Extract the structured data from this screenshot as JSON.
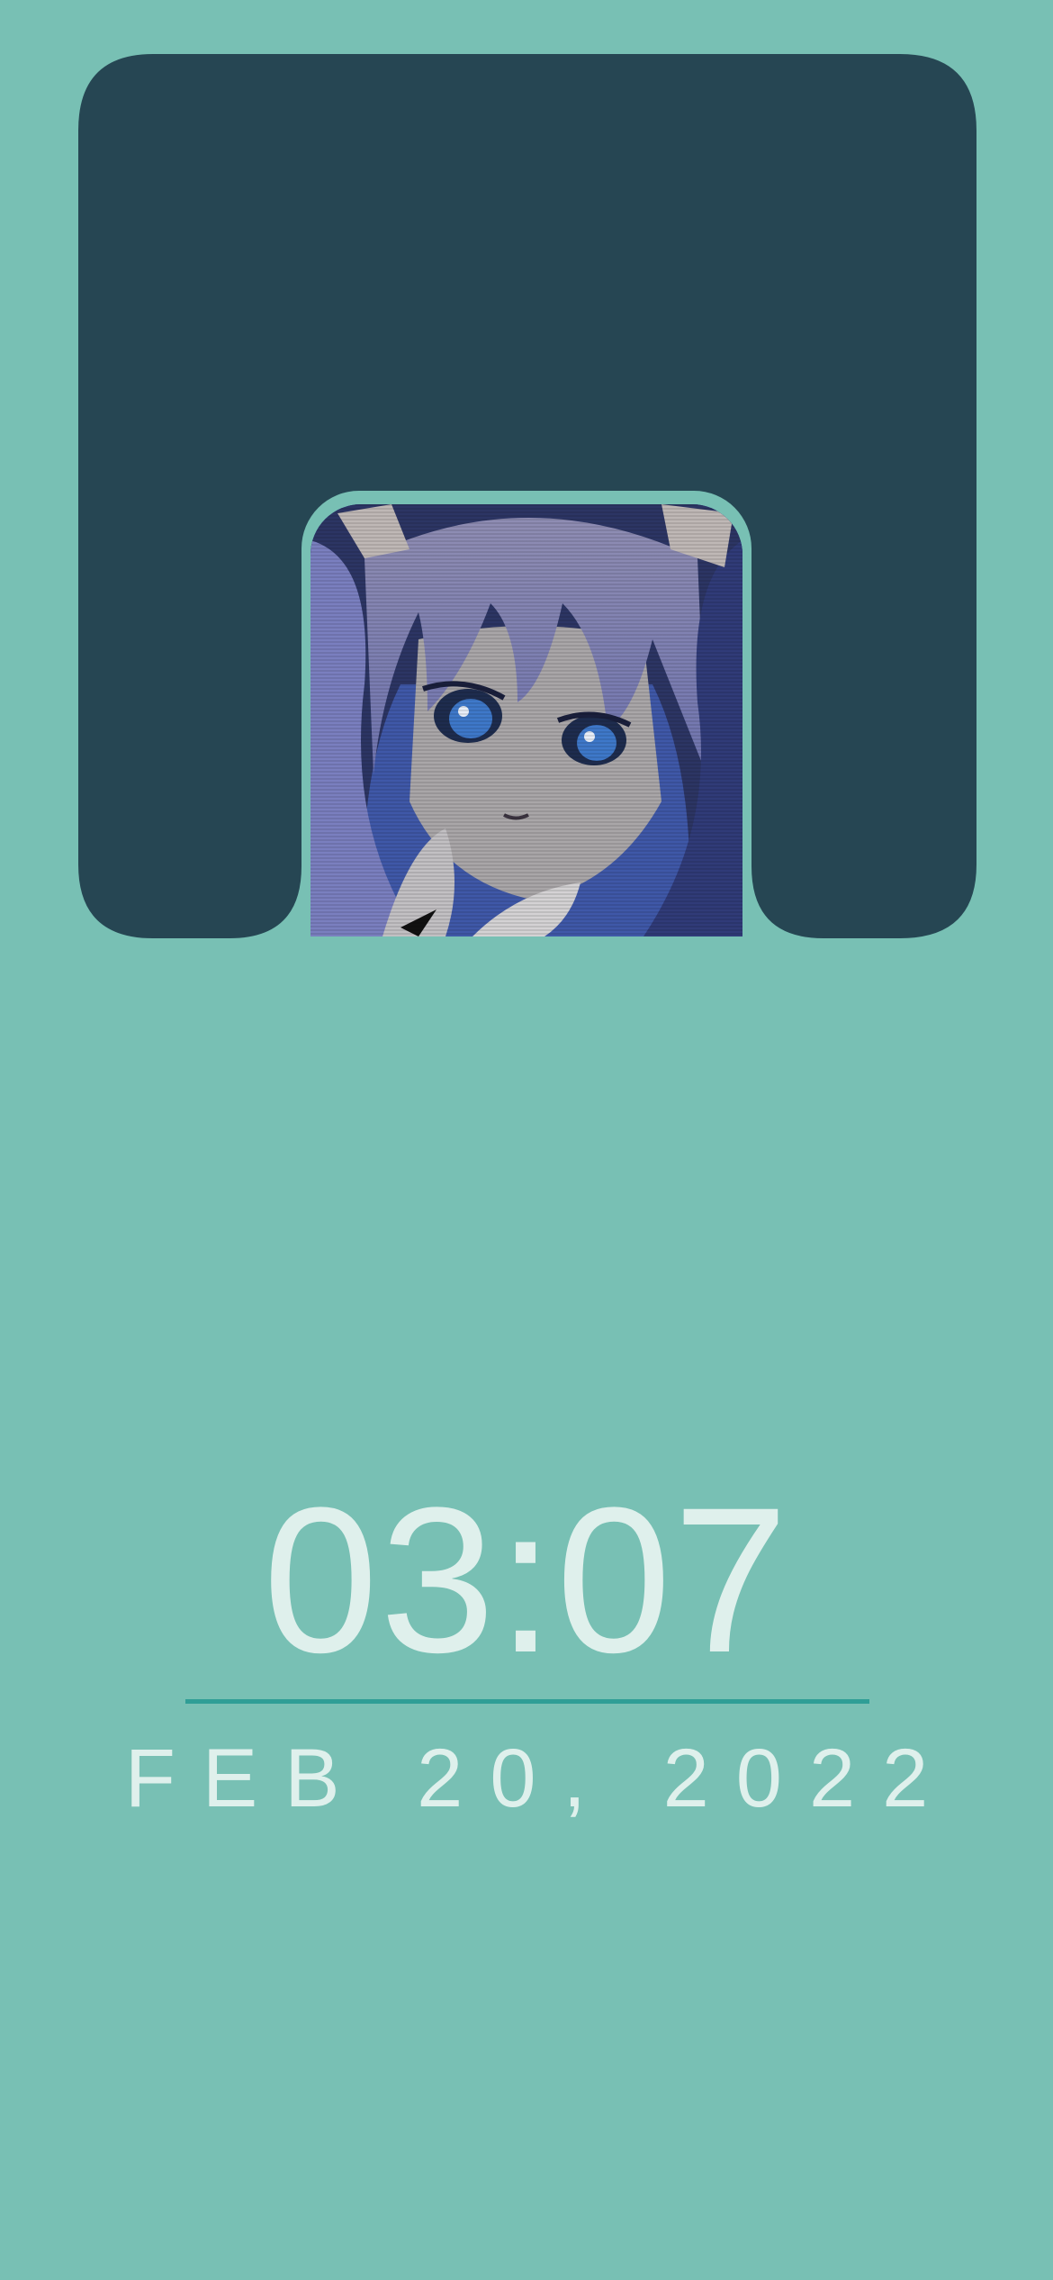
{
  "background_color": "#78c0b4",
  "header_card": {
    "color": "#264653",
    "avatar": {
      "icon": "anime-character-portrait",
      "frame_color": "#78c0b4"
    }
  },
  "clock": {
    "time": "03:07",
    "date": "FEB 20, 2022",
    "text_color": "#dff0ec",
    "divider_color": "#2f9e96"
  }
}
